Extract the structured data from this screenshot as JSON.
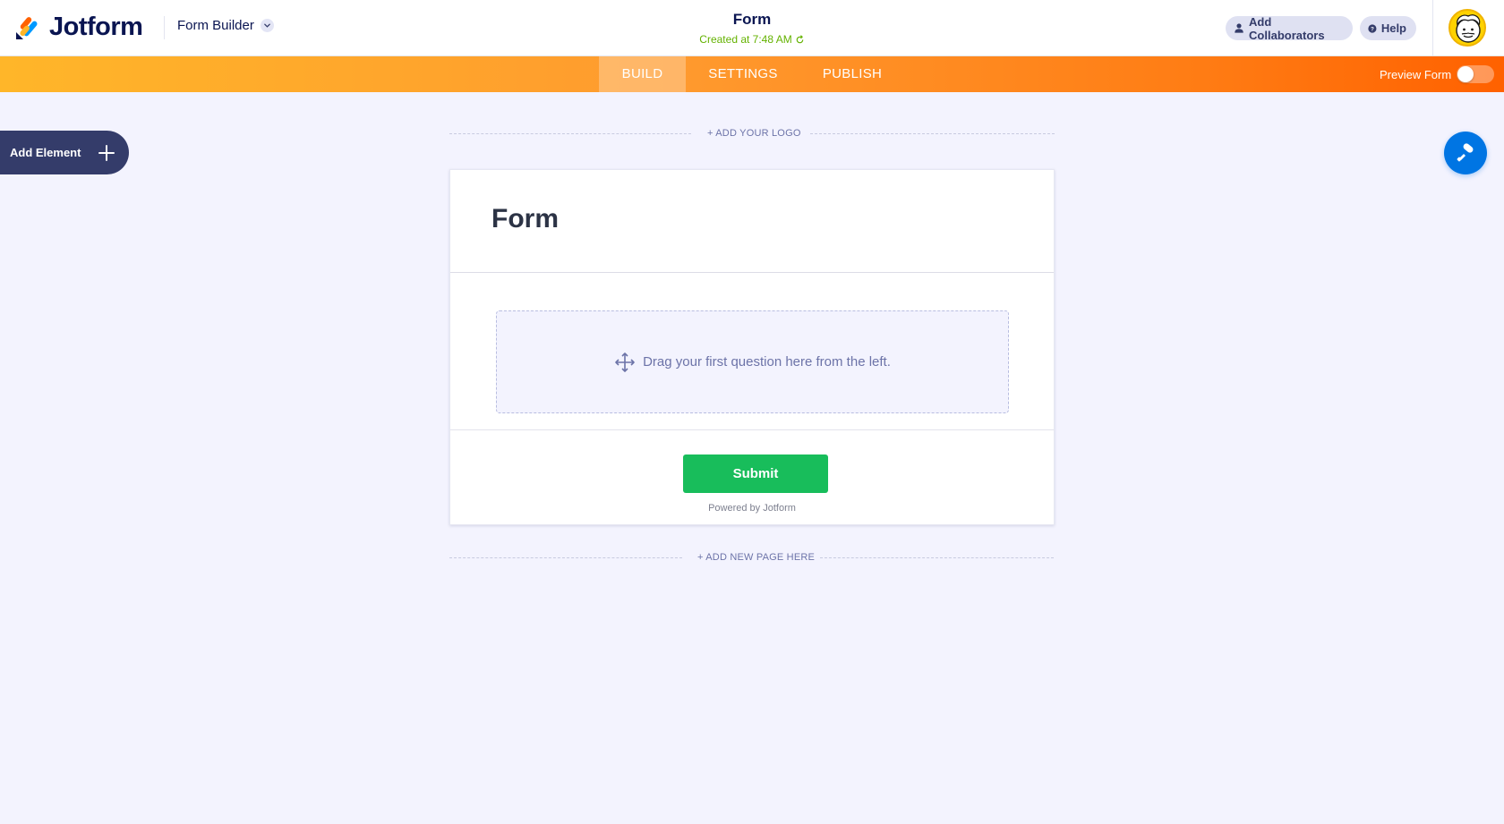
{
  "header": {
    "brand": "Jotform",
    "product_switcher": "Form Builder",
    "form_title": "Form",
    "created_text": "Created at 7:48 AM",
    "collaborators_label": "Add Collaborators",
    "help_label": "Help"
  },
  "nav": {
    "tabs": [
      {
        "label": "BUILD",
        "active": true
      },
      {
        "label": "SETTINGS",
        "active": false
      },
      {
        "label": "PUBLISH",
        "active": false
      }
    ],
    "preview_label": "Preview Form",
    "preview_enabled": false
  },
  "sidebar": {
    "add_element_label": "Add Element"
  },
  "canvas": {
    "add_logo_label": "+ ADD YOUR LOGO",
    "form_heading": "Form",
    "dropzone_text": "Drag your first question here from the left.",
    "submit_label": "Submit",
    "powered_by": "Powered by Jotform",
    "add_page_label": "+ ADD NEW PAGE HERE"
  },
  "colors": {
    "brand_navy": "#0a1551",
    "nav_orange_start": "#ffb629",
    "nav_orange_end": "#ff6100",
    "submit_green": "#18bd5b",
    "design_blue": "#0075e3",
    "created_green": "#64b200"
  },
  "icons": {
    "logo": "jotform-logo-icon",
    "chevron": "chevron-down-icon",
    "refresh": "refresh-icon",
    "user": "user-icon",
    "help": "help-icon",
    "plus": "plus-icon",
    "move": "move-icon",
    "paint_roller": "paint-roller-icon"
  }
}
